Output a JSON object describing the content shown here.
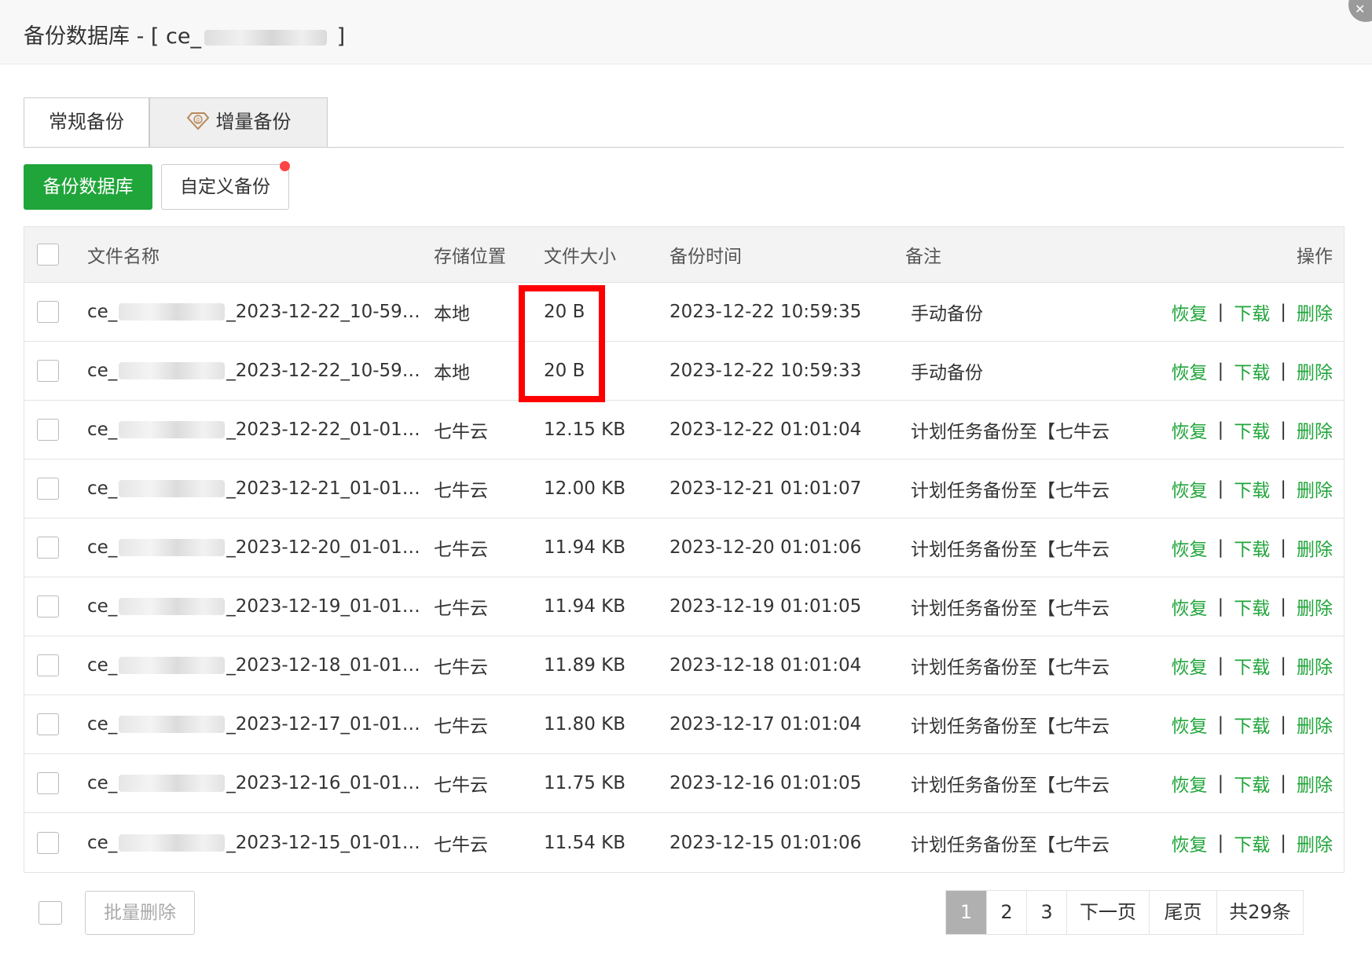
{
  "dialog": {
    "title_prefix": "备份数据库 - [ ce_",
    "title_suffix": " ]"
  },
  "tabs": [
    {
      "label": "常规备份",
      "active": true
    },
    {
      "label": "增量备份",
      "active": false,
      "icon": "enterprise-diamond-icon"
    }
  ],
  "toolbar": {
    "backup_label": "备份数据库",
    "custom_label": "自定义备份"
  },
  "table": {
    "headers": {
      "name": "文件名称",
      "location": "存储位置",
      "size": "文件大小",
      "time": "备份时间",
      "note": "备注",
      "ops": "操作"
    },
    "rows": [
      {
        "name_prefix": "ce_",
        "name_suffix": "_2023-12-22_10-59…",
        "location": "本地",
        "size": "20 B",
        "time": "2023-12-22 10:59:35",
        "note": "手动备份"
      },
      {
        "name_prefix": "ce_",
        "name_suffix": "_2023-12-22_10-59…",
        "location": "本地",
        "size": "20 B",
        "time": "2023-12-22 10:59:33",
        "note": "手动备份"
      },
      {
        "name_prefix": "ce_",
        "name_suffix": "_2023-12-22_01-01…",
        "location": "七牛云",
        "size": "12.15 KB",
        "time": "2023-12-22 01:01:04",
        "note": "计划任务备份至【七牛云"
      },
      {
        "name_prefix": "ce_",
        "name_suffix": "_2023-12-21_01-01…",
        "location": "七牛云",
        "size": "12.00 KB",
        "time": "2023-12-21 01:01:07",
        "note": "计划任务备份至【七牛云"
      },
      {
        "name_prefix": "ce_",
        "name_suffix": "_2023-12-20_01-01…",
        "location": "七牛云",
        "size": "11.94 KB",
        "time": "2023-12-20 01:01:06",
        "note": "计划任务备份至【七牛云"
      },
      {
        "name_prefix": "ce_",
        "name_suffix": "_2023-12-19_01-01…",
        "location": "七牛云",
        "size": "11.94 KB",
        "time": "2023-12-19 01:01:05",
        "note": "计划任务备份至【七牛云"
      },
      {
        "name_prefix": "ce_",
        "name_suffix": "_2023-12-18_01-01…",
        "location": "七牛云",
        "size": "11.89 KB",
        "time": "2023-12-18 01:01:04",
        "note": "计划任务备份至【七牛云"
      },
      {
        "name_prefix": "ce_",
        "name_suffix": "_2023-12-17_01-01…",
        "location": "七牛云",
        "size": "11.80 KB",
        "time": "2023-12-17 01:01:04",
        "note": "计划任务备份至【七牛云"
      },
      {
        "name_prefix": "ce_",
        "name_suffix": "_2023-12-16_01-01…",
        "location": "七牛云",
        "size": "11.75 KB",
        "time": "2023-12-16 01:01:05",
        "note": "计划任务备份至【七牛云"
      },
      {
        "name_prefix": "ce_",
        "name_suffix": "_2023-12-15_01-01…",
        "location": "七牛云",
        "size": "11.54 KB",
        "time": "2023-12-15 01:01:06",
        "note": "计划任务备份至【七牛云"
      }
    ],
    "ops": {
      "restore": "恢复",
      "download": "下载",
      "delete": "删除",
      "separator": "|"
    }
  },
  "footer": {
    "batch_delete": "批量删除",
    "pagination": [
      {
        "label": "1",
        "active": true
      },
      {
        "label": "2",
        "active": false
      },
      {
        "label": "3",
        "active": false
      },
      {
        "label": "下一页",
        "active": false
      },
      {
        "label": "尾页",
        "active": false
      },
      {
        "label": "共29条",
        "active": false
      }
    ]
  },
  "colors": {
    "accent": "#20a53a",
    "highlight": "#ff0000",
    "page_active": "#b0b0b0"
  }
}
